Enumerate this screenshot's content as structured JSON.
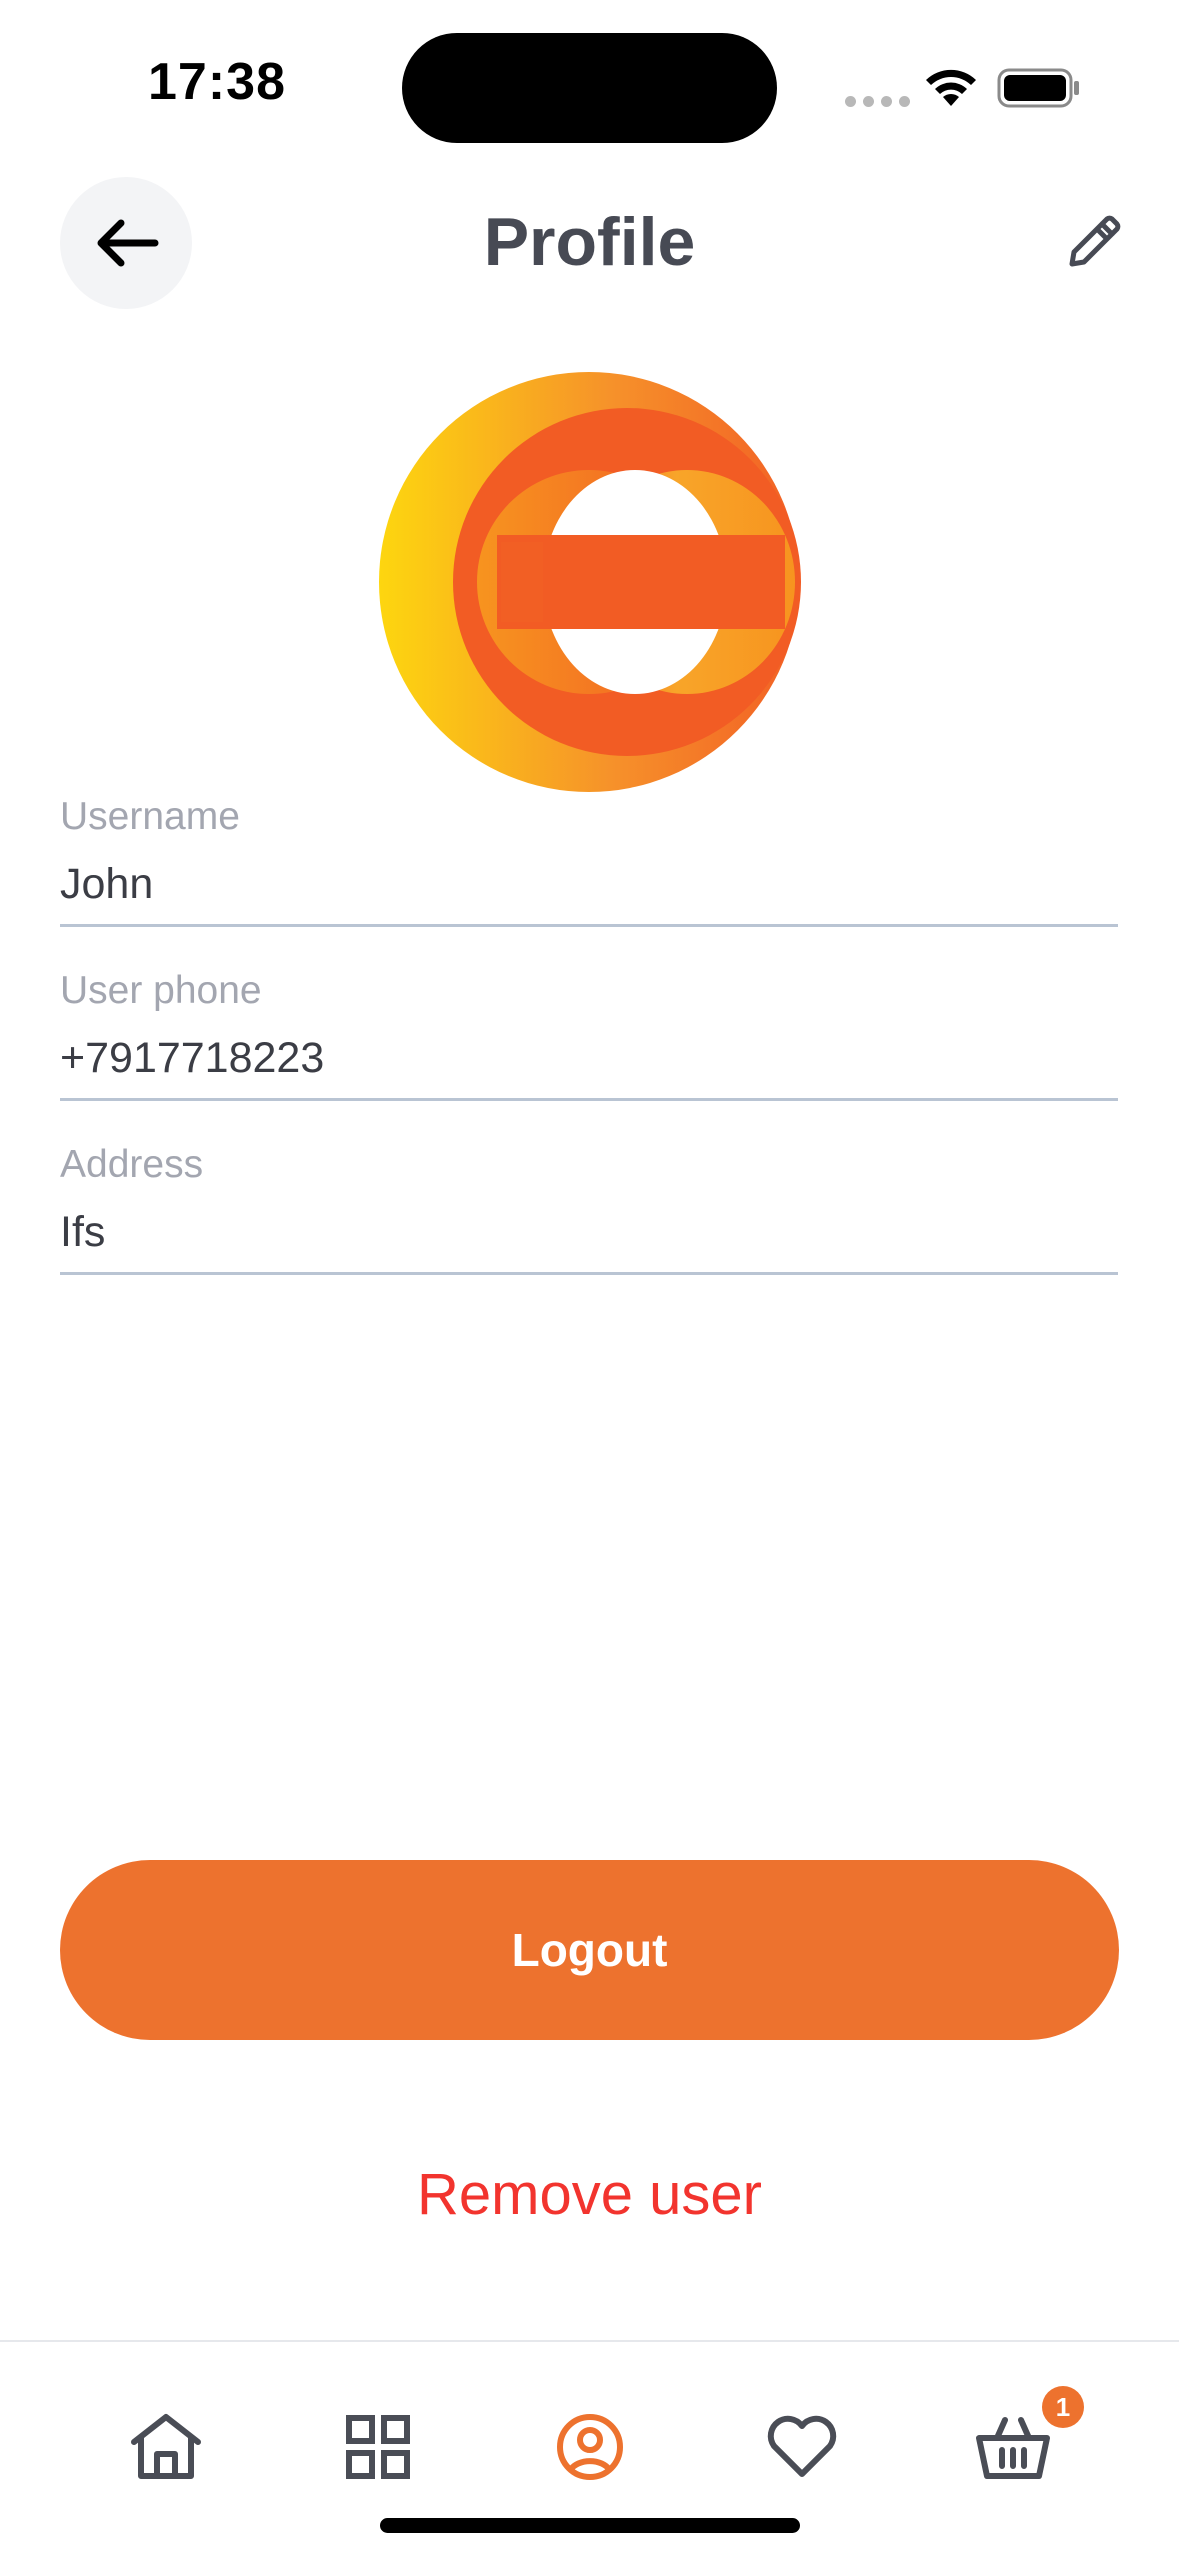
{
  "status_bar": {
    "time": "17:38"
  },
  "header": {
    "title": "Profile",
    "back_icon": "arrow-left-icon",
    "edit_icon": "pencil-icon"
  },
  "avatar": {
    "icon": "orange-circle-logo"
  },
  "fields": [
    {
      "label": "Username",
      "value": "John"
    },
    {
      "label": "User phone",
      "value": "+7917718223"
    },
    {
      "label": "Address",
      "value": "Ifs"
    }
  ],
  "actions": {
    "logout_label": "Logout",
    "remove_label": "Remove user"
  },
  "tab_bar": {
    "items": [
      {
        "icon": "home-icon",
        "active": false
      },
      {
        "icon": "grid-icon",
        "active": false
      },
      {
        "icon": "user-circle-icon",
        "active": true
      },
      {
        "icon": "heart-icon",
        "active": false
      },
      {
        "icon": "basket-icon",
        "active": false
      }
    ],
    "cart_badge": "1"
  },
  "colors": {
    "accent": "#ed722e",
    "danger": "#f2342e",
    "text": "#3b3d45",
    "label": "#a3a6b0",
    "divider": "#b9c4d3"
  }
}
